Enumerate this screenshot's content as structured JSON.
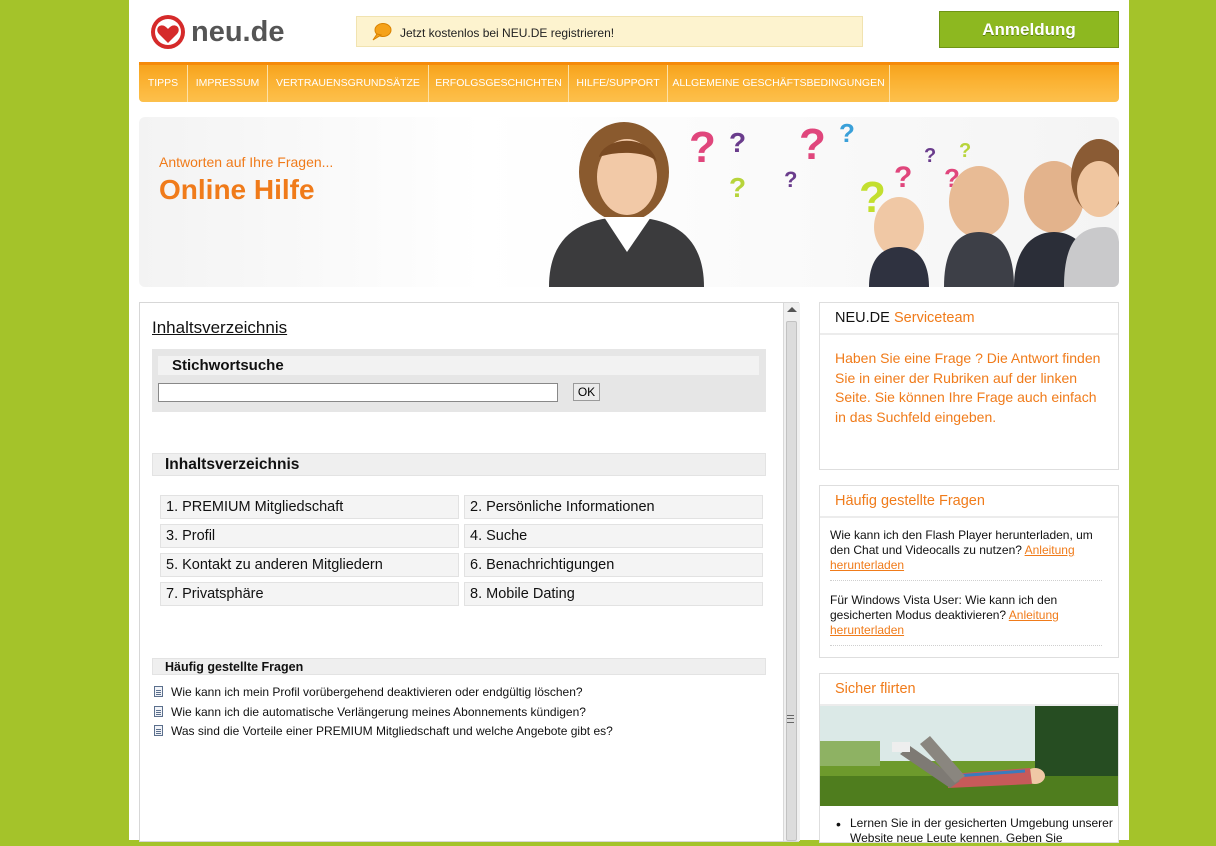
{
  "header": {
    "logo_text": "neu.de",
    "notice": "Jetzt kostenlos bei NEU.DE registrieren!",
    "login_label": "Anmeldung"
  },
  "nav": [
    "TIPPS",
    "IMPRESSUM",
    "VERTRAUENSGRUNDSÄTZE",
    "ERFOLGSGESCHICHTEN",
    "HILFE/SUPPORT",
    "ALLGEMEINE GESCHÄFTSBEDINGUNGEN"
  ],
  "banner": {
    "subtitle": "Antworten auf Ihre Fragen...",
    "title": "Online Hilfe"
  },
  "main": {
    "toc_link": "Inhaltsverzeichnis",
    "search": {
      "title": "Stichwortsuche",
      "value": "",
      "button": "OK"
    },
    "toc": {
      "title": "Inhaltsverzeichnis",
      "items": [
        "1. PREMIUM Mitgliedschaft",
        "2. Persönliche Informationen",
        "3. Profil",
        "4. Suche",
        "5. Kontakt zu anderen Mitgliedern",
        "6. Benachrichtigungen",
        "7. Privatsphäre",
        "8. Mobile Dating"
      ]
    },
    "faq": {
      "title": "Häufig gestellte Fragen",
      "items": [
        "Wie kann ich mein Profil vorübergehend deaktivieren oder endgültig löschen?",
        "Wie kann ich die automatische Verlängerung meines Abonnements kündigen?",
        "Was sind die Vorteile einer PREMIUM Mitgliedschaft und welche Angebote gibt es?"
      ]
    }
  },
  "sidebar": {
    "service": {
      "title_prefix": "NEU.DE",
      "title_accent": "Serviceteam",
      "text": "Haben Sie eine Frage ? Die Antwort finden Sie in einer der Rubriken auf der linken Seite. Sie können Ihre Frage auch einfach in das Suchfeld eingeben."
    },
    "faq": {
      "title": "Häufig gestellte Fragen",
      "items": [
        {
          "question": "Wie kann ich den Flash Player herunterladen, um den Chat und Videocalls zu nutzen?",
          "link": "Anleitung herunterladen"
        },
        {
          "question": "Für Windows Vista User: Wie kann ich den gesicherten Modus deaktivieren?",
          "link": "Anleitung herunterladen"
        }
      ]
    },
    "flirt": {
      "title": "Sicher flirten",
      "bullet": "Lernen Sie in der gesicherten Umgebung unserer Website neue Leute kennen. Geben Sie"
    }
  },
  "colors": {
    "background": "#a4c32a",
    "accent_orange": "#f07b1a",
    "nav_orange": "#fbb233",
    "login_green": "#8db820"
  }
}
